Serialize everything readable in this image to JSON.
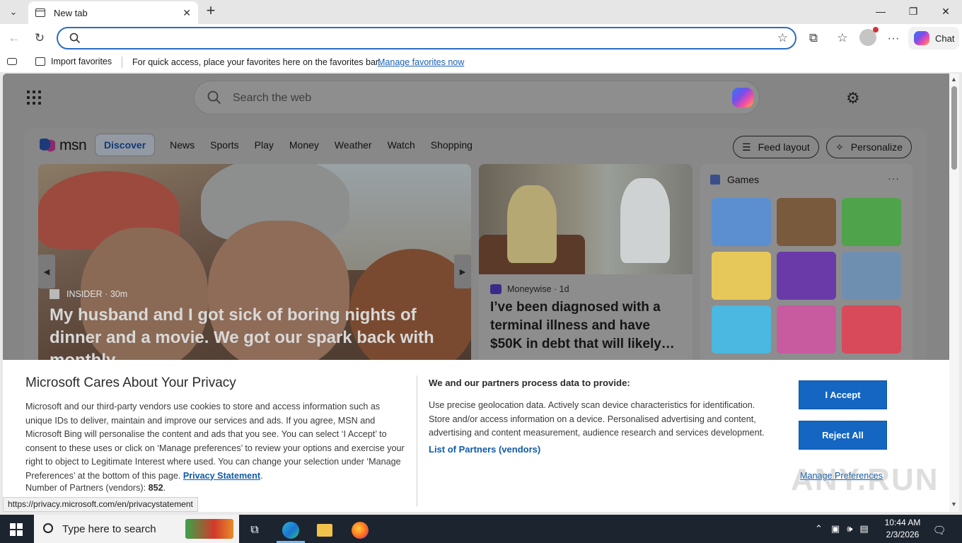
{
  "browser": {
    "tab_title": "New tab",
    "address_value": "",
    "chat_label": "Chat",
    "favorites": {
      "import_label": "Import favorites",
      "message": "For quick access, place your favorites here on the favorites bar.",
      "manage_link": "Manage favorites now"
    }
  },
  "newtab": {
    "search_placeholder": "Search the web",
    "msn": {
      "logo": "msn",
      "nav": [
        "Discover",
        "News",
        "Sports",
        "Play",
        "Money",
        "Weather",
        "Watch",
        "Shopping"
      ],
      "feed_layout": "Feed layout",
      "personalize": "Personalize"
    },
    "hero": {
      "source": "INSIDER",
      "age": "· 30m",
      "headline": "My husband and I got sick of boring nights of dinner and a movie. We got our spark back with monthly…"
    },
    "story2": {
      "source": "Moneywise",
      "age": "· 1d",
      "headline": "I’ve been diagnosed with a terminal illness and have $50K in debt that will likely…"
    },
    "games": {
      "title": "Games",
      "more": "···",
      "tiles": [
        "#5b8fd0",
        "#7a5a3c",
        "#4fa34a",
        "#e6c85a",
        "#6a3aa8",
        "#6f8fb0",
        "#4ab8e0",
        "#c85aa0",
        "#d84a5a"
      ]
    }
  },
  "privacy": {
    "title": "Microsoft Cares About Your Privacy",
    "body": "Microsoft and our third-party vendors use cookies to store and access information such as unique IDs to deliver, maintain and improve our services and ads. If you agree, MSN and Microsoft Bing will personalise the content and ads that you see. You can select ‘I Accept’ to consent to these uses or click on ‘Manage preferences’ to review your options and exercise your right to object to Legitimate Interest where used.  You can change your selection under ‘Manage Preferences’ at the bottom of this page.",
    "statement_link": "Privacy Statement",
    "partners_label": "Number of Partners (vendors):",
    "partners_count": "852",
    "subtitle": "We and our partners process data to provide:",
    "purposes": "Use precise geolocation data. Actively scan device characteristics for identification. Store and/or access information on a device. Personalised advertising and content, advertising and content measurement, audience research and services development.",
    "list_link": "List of Partners (vendors)",
    "accept": "I Accept",
    "reject": "Reject All",
    "manage": "Manage Preferences"
  },
  "status_url": "https://privacy.microsoft.com/en/privacystatement",
  "watermark": "ANY.RUN",
  "taskbar": {
    "search_placeholder": "Type here to search",
    "time": "10:44 AM",
    "date": "2/3/2026"
  }
}
